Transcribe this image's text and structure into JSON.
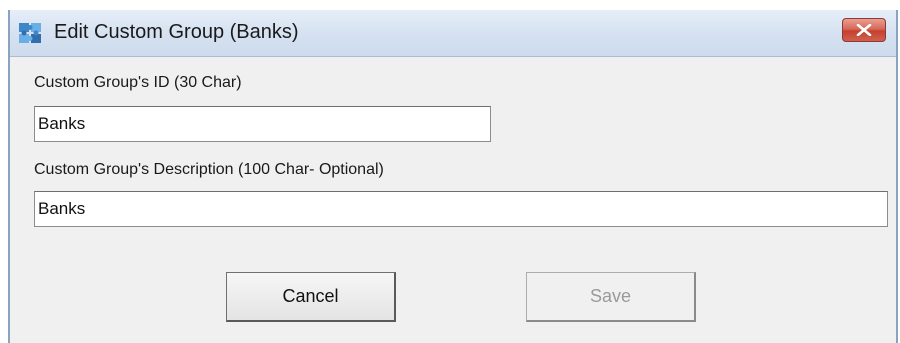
{
  "window": {
    "title": "Edit Custom Group (Banks)"
  },
  "form": {
    "id_label": "Custom Group's ID (30 Char)",
    "id_value": "Banks",
    "description_label": "Custom Group's Description (100 Char- Optional)",
    "description_value": "Banks"
  },
  "buttons": {
    "cancel_label": "Cancel",
    "save_label": "Save",
    "save_enabled": false
  },
  "icons": {
    "app": "app-puzzle-icon",
    "close": "close-icon"
  },
  "colors": {
    "titlebar": "#d6e2f1",
    "close_button": "#c4412f",
    "window_background": "#f0f0f0"
  }
}
